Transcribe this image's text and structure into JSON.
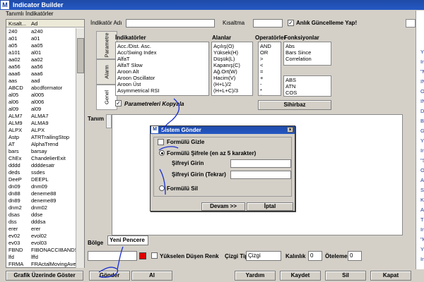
{
  "window": {
    "title": "Indicator Builder",
    "app_letter": "M"
  },
  "left_panel": {
    "label": "Tanımlı İndikatörler",
    "columns": [
      "Kısalt...",
      "Ad"
    ],
    "rows": [
      [
        "240",
        "a240"
      ],
      [
        "a01",
        "a01"
      ],
      [
        "a05",
        "aa05"
      ],
      [
        "a101",
        "al01"
      ],
      [
        "aa02",
        "aa02"
      ],
      [
        "aa56",
        "aa56"
      ],
      [
        "aaa6",
        "aaa6"
      ],
      [
        "aas",
        "aad"
      ],
      [
        "ABCD",
        "abcdformator"
      ],
      [
        "al05",
        "al005"
      ],
      [
        "al06",
        "al006"
      ],
      [
        "al09",
        "al09"
      ],
      [
        "ALM7",
        "ALMA7"
      ],
      [
        "ALM9",
        "ALMA9"
      ],
      [
        "ALPX",
        "ALPX"
      ],
      [
        "Astp",
        "ATRTrailingStop"
      ],
      [
        "AT",
        "AlphaTrend"
      ],
      [
        "bars",
        "barsay"
      ],
      [
        "ChEx",
        "ChandelierExit"
      ],
      [
        "dddd",
        "ddddesatr"
      ],
      [
        "deds",
        "ssdes"
      ],
      [
        "DeeP",
        "DEEPL"
      ],
      [
        "dn09",
        "dnm09"
      ],
      [
        "dn88",
        "deneme88"
      ],
      [
        "dn89",
        "deneme89"
      ],
      [
        "dnm2",
        "dnm02"
      ],
      [
        "dsas",
        "ddse"
      ],
      [
        "dss",
        "dddsa"
      ],
      [
        "erer",
        "erer"
      ],
      [
        "ev02",
        "evol02"
      ],
      [
        "ev03",
        "evol03"
      ],
      [
        "FBND",
        "FIBONACCIBANDS"
      ],
      [
        "lfd",
        "lffd"
      ],
      [
        "FRMA",
        "FRActalMovingAve"
      ]
    ],
    "show_on_chart_button": "Grafik Üzerinde Göster"
  },
  "top_form": {
    "name_label": "İndikatör Adı",
    "name_value": "",
    "short_label": "Kısaltma",
    "short_value": "",
    "instant_update_label": "Anlık Güncelleme Yap!",
    "instant_update_checked": true
  },
  "tabs": [
    "Parametre",
    "Alarm",
    "Genel"
  ],
  "indicators_box": {
    "label": "İndikatörler",
    "items": [
      "Acc./Dist. Asc.",
      "Acc/Swing Index",
      "AlfaT",
      "AlfaT Slow",
      "Aroon Alt",
      "Aroon Oscillator",
      "Aroon Üst",
      "Asymmetrical RSI"
    ]
  },
  "fields_box": {
    "label": "Alanlar",
    "items": [
      "Açılış(O)",
      "Yüksek(H)",
      "Düşük(L)",
      "Kapanış(C)",
      "Ağ.Ort(W)",
      "Hacim(V)",
      "(H+L)/2",
      "(H+L+C)/3"
    ]
  },
  "operators_box": {
    "label": "Operatörler",
    "items": [
      "AND",
      "OR",
      ">",
      "<",
      "=",
      "+",
      "-",
      "*",
      "/",
      "("
    ]
  },
  "functions_box": {
    "label": "Fonksiyonlar",
    "items_top": [
      "Abs",
      "Bars Since",
      "Correlation"
    ],
    "items_bottom": [
      "ABS",
      "ATN",
      "COS"
    ]
  },
  "copy_params": {
    "label": "Parametreleri Kopyala",
    "checked": true
  },
  "wizard_button": "Sihirbaz",
  "definition_label": "Tanım",
  "modal": {
    "title": "Sistem Gönder",
    "hide_formula_label": "Formülü Gizle",
    "encrypt_option": "Formülü Şifrele (en az 5 karakter)",
    "password_label": "Şifreyi Girin",
    "password_repeat_label": "Şifreyi Girin (Tekrar)",
    "delete_option": "Formülü Sil",
    "continue_button": "Devam >>",
    "cancel_button": "İptal",
    "selected_option": "encrypt"
  },
  "region": {
    "label": "Bölge",
    "value": "Yeni Pencere"
  },
  "style_row": {
    "rising_falling_label": "Yükselen Düşen Renk",
    "line_type_label": "Çizgi Tipi",
    "line_type_value": "Çizgi",
    "thickness_label": "Kalınlık",
    "thickness_value": "0",
    "offset_label": "Öteleme",
    "offset_value": "0",
    "color": "#e00000"
  },
  "bottom_buttons": [
    "Gönder",
    "Al",
    "Yardım",
    "Kaydet",
    "Sil",
    "Kapat"
  ],
  "right_panel": {
    "lines": [
      "Y",
      "In",
      "\"M",
      "IN",
      "O",
      "IN",
      "D",
      "B",
      "G",
      "Y",
      "In",
      "\"S",
      "O",
      "A",
      "S",
      "K",
      "A",
      "T",
      "In",
      "\"K",
      "Y",
      "In"
    ]
  },
  "colors": {
    "title_bar": "#2458c4",
    "window_bg": "#d4d0c8",
    "annotation": "#1a2fd0"
  }
}
